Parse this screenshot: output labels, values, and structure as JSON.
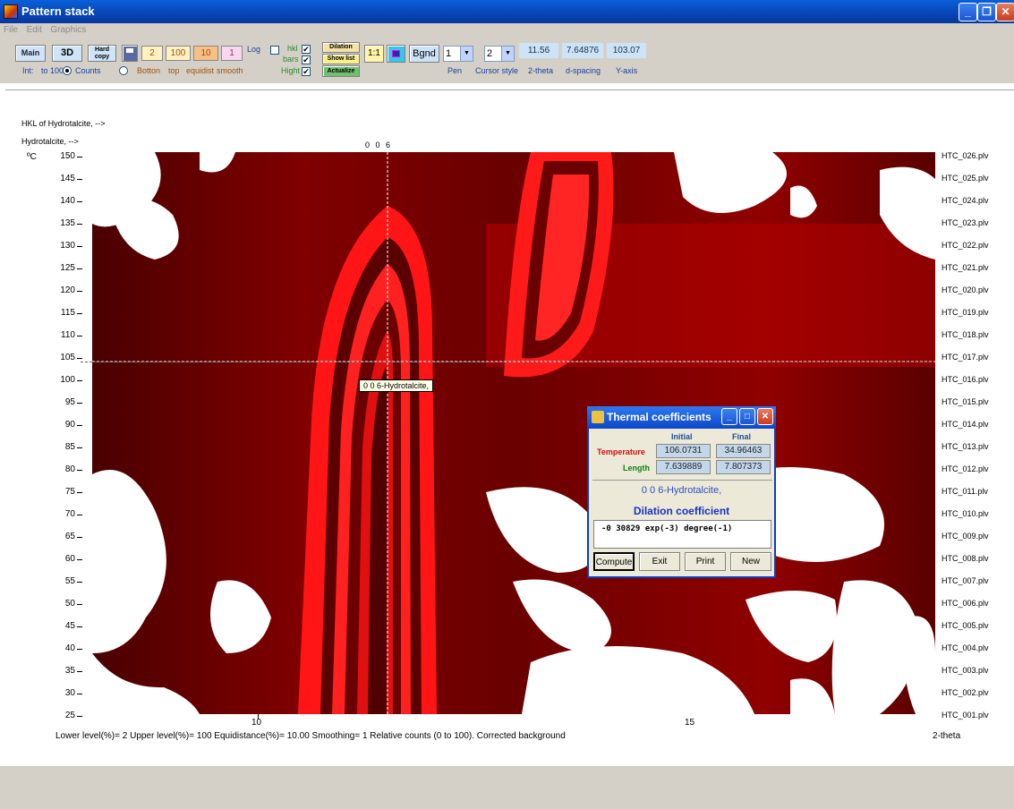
{
  "window": {
    "title": "Pattern stack",
    "controls": [
      "_",
      "❐",
      "✕"
    ]
  },
  "menu": [
    "File",
    "Edit",
    "Graphics"
  ],
  "toolbar": {
    "main_label": "Main",
    "btn3d_label": "3D",
    "hardcopy_label": "Hard copy",
    "lower_level": "2",
    "upper_level": "100",
    "equidistance": "10",
    "smoothing": "1",
    "log_label": "Log",
    "hkl_label": "hkl",
    "bars_label": "bars",
    "hight_label": "Hight",
    "dilation_label": "Dilation",
    "showlist_label": "Show list",
    "actualize_label": "Actualize",
    "ratio_label": "1:1",
    "bgnd_label": "Bgnd",
    "pen_value": "1",
    "cursor_value": "2",
    "pen_label": "Pen",
    "cursor_label": "Cursor style",
    "readout_2theta": "11.56",
    "readout_dspacing": "7.64876",
    "readout_yaxis": "103.07",
    "label_2theta": "2-theta",
    "label_dspacing": "d-spacing",
    "label_yaxis": "Y-axis",
    "int_label": "Int:",
    "to100_label": "to 100",
    "counts_label": "Counts",
    "bottom_label": "Botton",
    "top_label": "top",
    "equidist_label": "equidist",
    "smooth_label": "smooth"
  },
  "plot": {
    "hkl_header": "HKL of Hydrotalcite, -->",
    "phase_header": "Hydrotalcite, -->",
    "hkl_marker": "0 0 6",
    "y_unit": "ºC",
    "y_ticks": [
      "150",
      "145",
      "140",
      "135",
      "130",
      "125",
      "120",
      "115",
      "110",
      "105",
      "100",
      "95",
      "90",
      "85",
      "80",
      "75",
      "70",
      "65",
      "60",
      "55",
      "50",
      "45",
      "40",
      "35",
      "30",
      "25"
    ],
    "x_ticks": [
      "10",
      "15"
    ],
    "x_axis_label": "2-theta",
    "files": [
      "HTC_026.plv",
      "HTC_025.plv",
      "HTC_024.plv",
      "HTC_023.plv",
      "HTC_022.plv",
      "HTC_021.plv",
      "HTC_020.plv",
      "HTC_019.plv",
      "HTC_018.plv",
      "HTC_017.plv",
      "HTC_016.plv",
      "HTC_015.plv",
      "HTC_014.plv",
      "HTC_013.plv",
      "HTC_012.plv",
      "HTC_011.plv",
      "HTC_010.plv",
      "HTC_009.plv",
      "HTC_008.plv",
      "HTC_007.plv",
      "HTC_006.plv",
      "HTC_005.plv",
      "HTC_004.plv",
      "HTC_003.plv",
      "HTC_002.plv",
      "HTC_001.plv"
    ],
    "tooltip": "0  0  6-Hydrotalcite,",
    "status_line": "Lower level(%)= 2   Upper level(%)= 100   Equidistance(%)= 10.00   Smoothing= 1   Relative counts (0 to 100). Corrected background"
  },
  "dialog": {
    "title": "Thermal coefficients",
    "initial_header": "Initial",
    "final_header": "Final",
    "temperature_label": "Temperature",
    "length_label": "Length",
    "temp_initial": "106.0731",
    "temp_final": "34.96463",
    "length_initial": "7.639889",
    "length_final": "7.807373",
    "reflection": "0  0  6-Hydrotalcite,",
    "coef_title": "Dilation coefficient",
    "coef_value": "-0 30829  exp(-3)  degree(-1)",
    "buttons": [
      "Compute",
      "Exit",
      "Print",
      "New"
    ]
  },
  "colors": {
    "heatmap_dark": "#3a0000",
    "heatmap_bright": "#ff1010",
    "accent_blue": "#0b48c8"
  }
}
